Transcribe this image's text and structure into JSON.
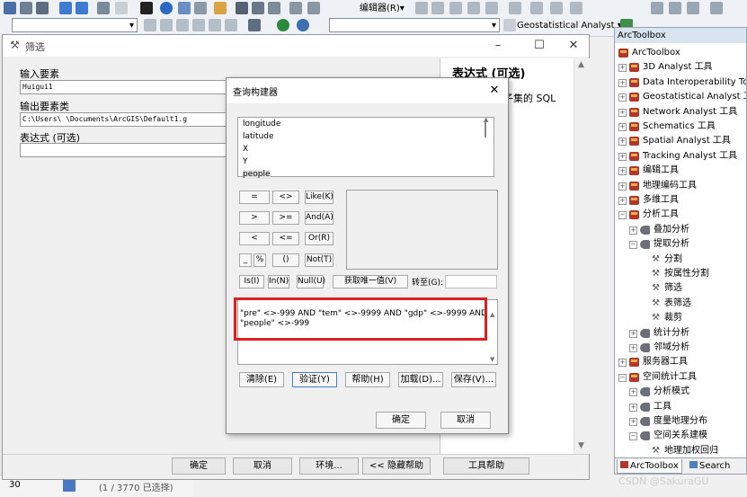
{
  "toolbar": {
    "editor_menu": "编辑器(R)▾",
    "geostatistical_menu": "Geostatistical Analyst ▾"
  },
  "status": {
    "scale": "30",
    "selection_count": "(1 / 3770 已选择)"
  },
  "filter_window": {
    "title": "筛选",
    "input_label": "输入要素",
    "input_value": "Huigui1",
    "output_label": "输出要素类",
    "output_value": "C:\\Users\\          \\Documents\\ArcGIS\\Default1.g",
    "expression_label": "表达式 (可选)",
    "help_title": "表达式 (可选)",
    "help_text": "子集的 SQL",
    "buttons": [
      "确定",
      "取消",
      "环境...",
      "<< 隐藏帮助",
      "工具帮助"
    ]
  },
  "query_builder": {
    "title": "查询构建器",
    "fields": [
      "longitude",
      "latitude",
      "X",
      "Y",
      "people"
    ],
    "selected_field": "people",
    "operators": [
      [
        "=",
        "<>",
        "Like(K)"
      ],
      [
        ">",
        ">=",
        "And(A)"
      ],
      [
        "<",
        "<=",
        "Or(R)"
      ],
      [
        "_",
        "%",
        "()",
        "Not(T)"
      ]
    ],
    "row5": {
      "is": "Is(I)",
      "in": "In(N)",
      "null": "Null(U)",
      "unique": "获取唯一值(V)",
      "goto": "转至(G):"
    },
    "expression": "\"pre\" <>-999 AND \"tem\" <>-9999 AND \"gdp\" <>-9999 AND \"people\" <>-999",
    "action_buttons": [
      "清除(E)",
      "验证(Y)",
      "帮助(H)",
      "加载(D)...",
      "保存(V)..."
    ],
    "ok": "确定",
    "cancel": "取消"
  },
  "arctoolbox": {
    "title": "ArcToolbox",
    "items": [
      {
        "label": "ArcToolbox",
        "kind": "root"
      },
      {
        "label": "3D Analyst 工具",
        "kind": "toolbox"
      },
      {
        "label": "Data Interoperability To",
        "kind": "toolbox"
      },
      {
        "label": "Geostatistical Analyst 工",
        "kind": "toolbox"
      },
      {
        "label": "Network Analyst 工具",
        "kind": "toolbox"
      },
      {
        "label": "Schematics 工具",
        "kind": "toolbox"
      },
      {
        "label": "Spatial Analyst 工具",
        "kind": "toolbox"
      },
      {
        "label": "Tracking Analyst 工具",
        "kind": "toolbox"
      },
      {
        "label": "编辑工具",
        "kind": "toolbox"
      },
      {
        "label": "地理编码工具",
        "kind": "toolbox"
      },
      {
        "label": "多维工具",
        "kind": "toolbox"
      },
      {
        "label": "分析工具",
        "kind": "toolbox-open"
      },
      {
        "label": "叠加分析",
        "kind": "set"
      },
      {
        "label": "提取分析",
        "kind": "set-open"
      },
      {
        "label": "分割",
        "kind": "tool"
      },
      {
        "label": "按属性分割",
        "kind": "tool"
      },
      {
        "label": "筛选",
        "kind": "tool"
      },
      {
        "label": "表筛选",
        "kind": "tool"
      },
      {
        "label": "裁剪",
        "kind": "tool"
      },
      {
        "label": "统计分析",
        "kind": "set"
      },
      {
        "label": "邻域分析",
        "kind": "set"
      },
      {
        "label": "服务器工具",
        "kind": "toolbox"
      },
      {
        "label": "空间统计工具",
        "kind": "toolbox-open"
      },
      {
        "label": "分析模式",
        "kind": "set"
      },
      {
        "label": "工具",
        "kind": "set"
      },
      {
        "label": "度量地理分布",
        "kind": "set"
      },
      {
        "label": "空间关系建模",
        "kind": "set-open"
      },
      {
        "label": "地理加权回归",
        "kind": "tool"
      }
    ],
    "tabs": [
      "ArcToolbox",
      "Search"
    ]
  },
  "watermark": "CSDN @SakuraGU",
  "colors": {
    "highlight": "#e02020",
    "toolbox_red": "#b3362b"
  }
}
